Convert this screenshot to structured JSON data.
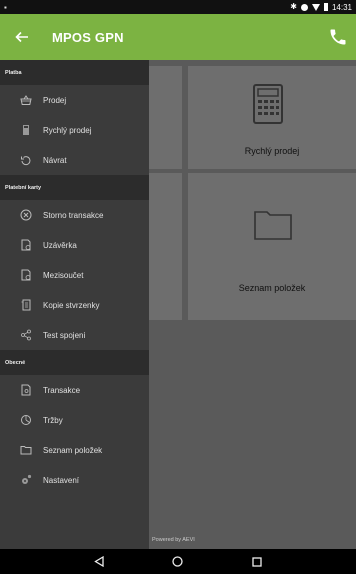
{
  "status_bar": {
    "time": "14:31"
  },
  "app_bar": {
    "title": "MPOS GPN"
  },
  "drawer": {
    "sections": [
      {
        "title": "Platba",
        "items": [
          {
            "label": "Prodej",
            "icon": "basket-icon"
          },
          {
            "label": "Rychlý prodej",
            "icon": "calculator-icon"
          },
          {
            "label": "Návrat",
            "icon": "undo-icon"
          }
        ]
      },
      {
        "title": "Platební karty",
        "items": [
          {
            "label": "Storno transakce",
            "icon": "cancel-circle-icon"
          },
          {
            "label": "Uzávěrka",
            "icon": "document-icon"
          },
          {
            "label": "Mezisoučet",
            "icon": "document-icon"
          },
          {
            "label": "Kopie stvrzenky",
            "icon": "receipt-icon"
          },
          {
            "label": "Test spojeni",
            "icon": "share-icon"
          }
        ]
      },
      {
        "title": "Obecné",
        "items": [
          {
            "label": "Transakce",
            "icon": "document-search-icon"
          },
          {
            "label": "Tržby",
            "icon": "pie-chart-icon"
          },
          {
            "label": "Seznam položek",
            "icon": "folder-icon"
          },
          {
            "label": "Nastavení",
            "icon": "gear-icon"
          }
        ]
      }
    ]
  },
  "main": {
    "tiles": [
      {
        "label": "Rychlý prodej",
        "icon": "calculator-icon"
      },
      {
        "label": "Seznam položek",
        "icon": "folder-icon"
      }
    ],
    "powered_by": "Powered by AEVI"
  },
  "colors": {
    "accent": "#7cb342",
    "drawer": "#3b3b3b",
    "section": "#2c2c2c",
    "content": "#5a5a5a",
    "tile": "#6e6e6e"
  }
}
